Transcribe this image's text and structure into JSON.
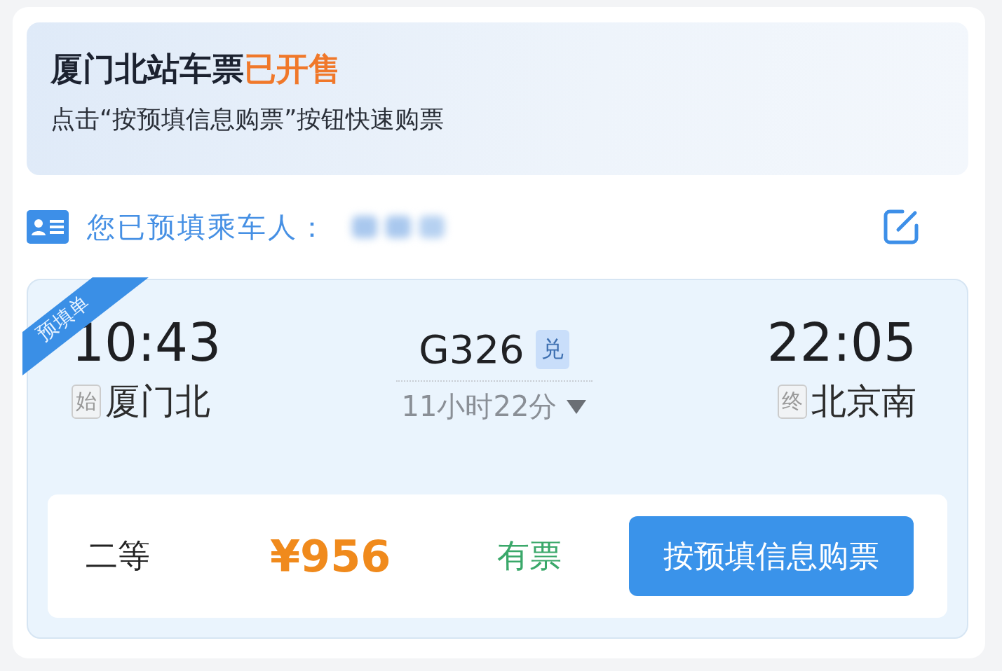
{
  "banner": {
    "title": "厦门北站车票",
    "title_highlight": "已开售",
    "subtitle": "点击“按预填信息购票”按钮快速购票"
  },
  "passenger": {
    "label": "您已预填乘车人："
  },
  "ticket": {
    "ribbon": "预填单",
    "depart_time": "10:43",
    "depart_tag": "始",
    "depart_station": "厦门北",
    "train_no": "G326",
    "train_badge": "兑",
    "duration": "11小时22分",
    "arrive_time": "22:05",
    "arrive_tag": "终",
    "arrive_station": "北京南",
    "seat": {
      "class": "二等",
      "price": "¥956",
      "availability": "有票",
      "button": "按预填信息购票"
    }
  }
}
